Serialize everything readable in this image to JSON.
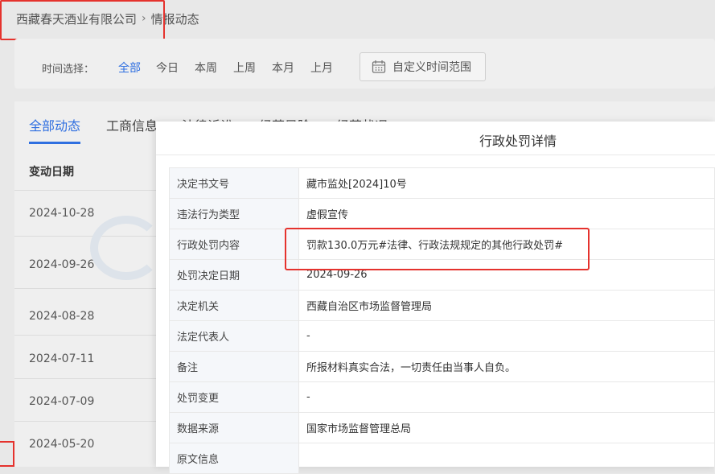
{
  "breadcrumb": {
    "company": "西藏春天酒业有限公司",
    "separator": "›",
    "current": "情报动态"
  },
  "filter": {
    "label": "时间选择：",
    "options": [
      "全部",
      "今日",
      "本周",
      "上周",
      "本月",
      "上月"
    ],
    "active_index": 0,
    "custom_range": "自定义时间范围"
  },
  "tabs": [
    "全部动态",
    "工商信息",
    "法律诉讼",
    "经营风险",
    "经营状况"
  ],
  "list": {
    "header": "变动日期",
    "dates": [
      "2024-10-28",
      "2024-09-26",
      "2024-08-28",
      "2024-07-11",
      "2024-07-09",
      "2024-05-20"
    ]
  },
  "modal": {
    "title": "行政处罚详情",
    "rows": [
      {
        "label": "决定书文号",
        "value": "藏市监处[2024]10号"
      },
      {
        "label": "违法行为类型",
        "value": "虚假宣传"
      },
      {
        "label": "行政处罚内容",
        "value": "罚款130.0万元#法律、行政法规规定的其他行政处罚#"
      },
      {
        "label": "处罚决定日期",
        "value": "2024-09-26"
      },
      {
        "label": "决定机关",
        "value": "西藏自治区市场监督管理局"
      },
      {
        "label": "法定代表人",
        "value": "-"
      },
      {
        "label": "备注",
        "value": "所报材料真实合法，一切责任由当事人自负。"
      },
      {
        "label": "处罚变更",
        "value": "-"
      },
      {
        "label": "数据来源",
        "value": "国家市场监督管理总局"
      },
      {
        "label": "原文信息",
        "value": ""
      }
    ]
  },
  "colors": {
    "accent": "#2f6fe0",
    "annotation_red": "#e5322d"
  }
}
